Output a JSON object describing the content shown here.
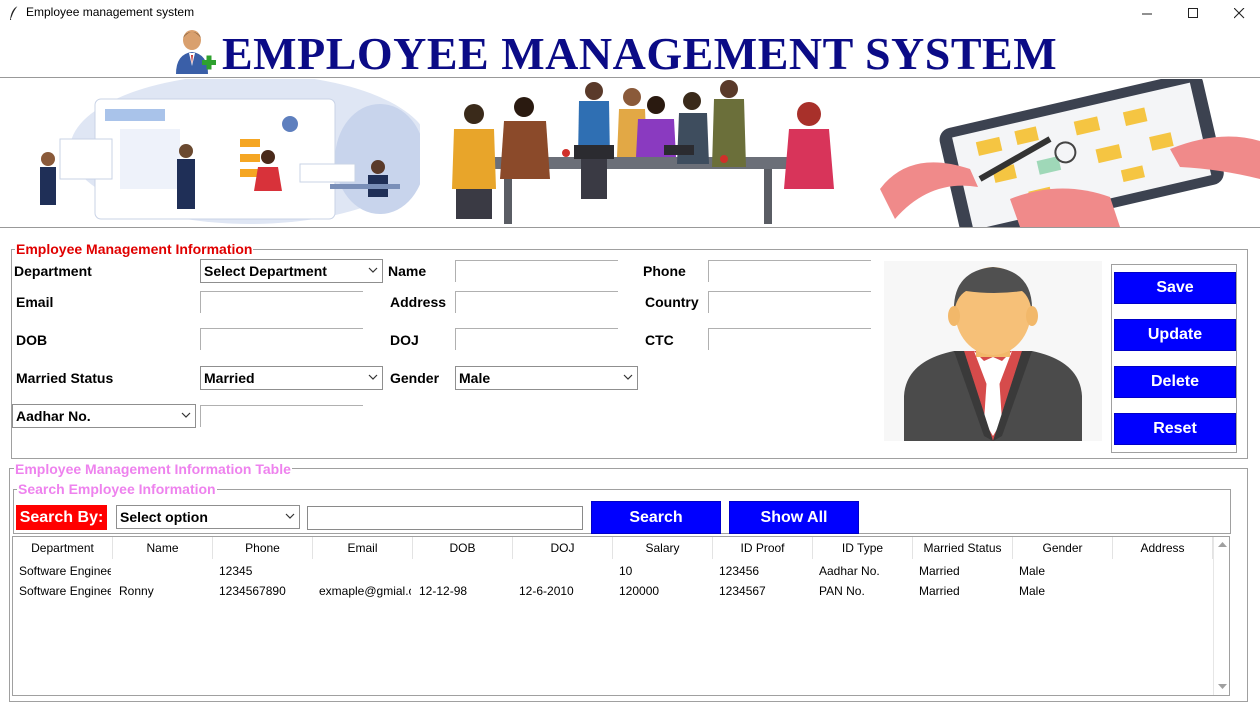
{
  "window": {
    "title": "Employee management system",
    "controls": {
      "minimize": "—",
      "maximize": "☐",
      "close": "✕"
    }
  },
  "header": {
    "title": "EMPLOYEE MANAGEMENT SYSTEM"
  },
  "info": {
    "legend": "Employee Management Information",
    "labels": {
      "department": "Department",
      "name": "Name",
      "phone": "Phone",
      "email": "Email",
      "address": "Address",
      "country": "Country",
      "dob": "DOB",
      "doj": "DOJ",
      "ctc": "CTC",
      "married_status": "Married Status",
      "gender": "Gender"
    },
    "department_select": "Select Department",
    "married_select": "Married",
    "gender_select": "Male",
    "id_type_select": "Aadhar No.",
    "fields": {
      "name": "",
      "phone": "",
      "email": "",
      "address": "",
      "country": "",
      "dob": "",
      "doj": "",
      "ctc": "",
      "id_number": ""
    }
  },
  "actions": {
    "save": "Save",
    "update": "Update",
    "delete": "Delete",
    "reset": "Reset"
  },
  "table_section": {
    "legend": "Employee Management Information Table",
    "search_legend": "Search Employee Information",
    "search_by_label": "Search By:",
    "search_select": "Select option",
    "search_value": "",
    "search_button": "Search",
    "show_all_button": "Show All"
  },
  "table": {
    "columns": [
      "Department",
      "Name",
      "Phone",
      "Email",
      "DOB",
      "DOJ",
      "Salary",
      "ID Proof",
      "ID Type",
      "Married Status",
      "Gender",
      "Address"
    ],
    "rows": [
      [
        "Software Enginee",
        "",
        "12345",
        "",
        "",
        "",
        "10",
        "123456",
        "Aadhar No.",
        "Married",
        "Male",
        ""
      ],
      [
        "Software Enginee",
        "Ronny",
        "1234567890",
        "exmaple@gmial.c",
        "12-12-98",
        "12-6-2010",
        "120000",
        "1234567",
        "PAN No.",
        "Married",
        "Male",
        ""
      ]
    ]
  },
  "colors": {
    "title_blue": "#0b0b86",
    "button_blue": "#0000ff",
    "legend_red": "#e00000",
    "legend_pink": "#ee82ee"
  }
}
